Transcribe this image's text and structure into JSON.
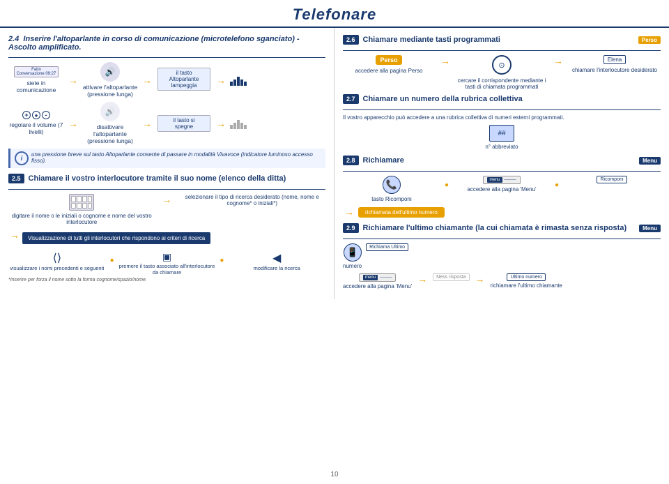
{
  "page": {
    "title": "Telefonare",
    "footer_page": "10"
  },
  "sec24": {
    "num": "2.4",
    "title": "Inserire l'altoparlante in corso di comunicazione (microtelefono sganciato) - Ascolto amplificato.",
    "steps": [
      {
        "label": "siete in comunicazione",
        "icon": "display"
      },
      {
        "label": "attivare l'altoparlante (pressione lunga)",
        "icon": "speaker"
      },
      {
        "label": "il tasto Altoparlante lampeggia",
        "icon": "tasto"
      },
      {
        "label": "",
        "icon": "audiobars"
      }
    ],
    "steps2": [
      {
        "label": "regolare il volume (7 livelli)",
        "icon": "volume"
      },
      {
        "label": "disattivare l'altoparlante (pressione lunga)",
        "icon": "speaker"
      },
      {
        "label": "il tasto si spegne",
        "icon": "tasto2"
      },
      {
        "label": "",
        "icon": "audiobars2"
      }
    ],
    "info": "una pressione breve sul tasto Altoparlante consente di passare in modalità Vivavoce (indicatore luminoso accesso fisso)."
  },
  "sec25": {
    "num": "2.5",
    "title": "Chiamare il vostro interlocutore tramite il suo nome (elenco della ditta)",
    "step1": "digitare il nome o le iniziali o cognome e nome del vostro interlocutore",
    "step2_label": "selezionare il tipo di ricerca desiderato (nome, nome e cognome* o iniziali*)",
    "vis_text": "Visualizzazione di tutti gli interlocutori che rispondono ai criteri di ricerca",
    "bottom1": "visualizzare i nomi precedenti e seguenti",
    "bottom2": "premere il tasto associato all'interlocutore da chiamare",
    "bottom3": "modificare la ricerca",
    "footnote": "*Inserire per forza il nome sotto la forma cognome/spazio/nome."
  },
  "sec26": {
    "num": "2.6",
    "title": "Chiamare mediante tasti programmati",
    "badge": "Perso",
    "steps": [
      {
        "label": "accedere alla pagina Perso",
        "icon": "perso"
      },
      {
        "label": "cercare il corrispondente mediante i tasti di chiamata programmati",
        "icon": "circle"
      },
      {
        "label": "chiamare l'interlocutore desiderato",
        "icon": "elena"
      }
    ]
  },
  "sec27": {
    "num": "2.7",
    "title": "Chiamare un numero della rubrica collettiva",
    "desc": "Il vostro apparecchio può accedere a una rubrica collettiva di numeri esterni programmati.",
    "label": "n° abbreviato"
  },
  "sec28": {
    "num": "2.8",
    "title": "Richiamare",
    "badge": "Menu",
    "steps": [
      {
        "label": "tasto Ricomponi",
        "icon": "phone"
      },
      {
        "label": "accedere alla pagina 'Menu'",
        "icon": "menu"
      },
      {
        "label": "",
        "icon": "ricomponi"
      }
    ],
    "callback": "richiamata dell'ultimo numero"
  },
  "sec29": {
    "num": "2.9",
    "title": "Richiamare l'ultimo chiamante (la cui chiamata è rimasta senza risposta)",
    "badge": "Menu",
    "step1": "accedere alla pagina 'Menu'",
    "step2": "richiamare l'ultimo chiamante",
    "labels": {
      "numero": "numero",
      "richiama_ultimo": "Richiama Ultimo",
      "ness_risposta": "Ness risposta",
      "ultimo_numero": "Ultimo numero"
    }
  }
}
